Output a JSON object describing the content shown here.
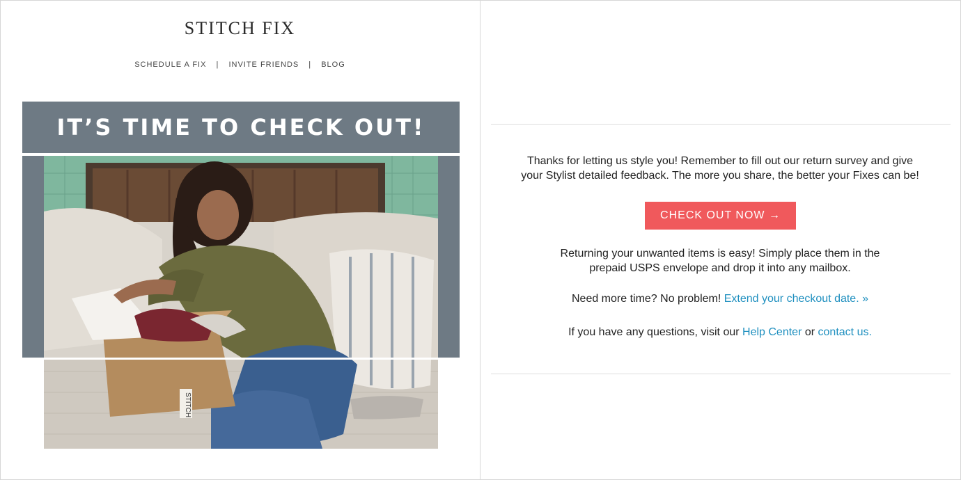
{
  "brand": {
    "logo": "STITCH FIX"
  },
  "nav": {
    "items": [
      "SCHEDULE A FIX",
      "INVITE FRIENDS",
      "BLOG"
    ],
    "separator": "|"
  },
  "banner": {
    "title": "IT’S TIME TO CHECK OUT!",
    "color": "#6e7a84"
  },
  "photo": {
    "box_label": "STITCH"
  },
  "content": {
    "intro_line1": "Thanks for letting us style you! Remember to fill out our return survey and give",
    "intro_line2": "your Stylist detailed feedback. The more you share, the better your Fixes can be!",
    "cta_label": "CHECK OUT NOW →",
    "cta_color": "#f0595c",
    "return_line1": "Returning your unwanted items is easy! Simply place them in the",
    "return_line2": "prepaid USPS envelope and drop it into any mailbox.",
    "more_time_text": "Need more time? No problem!",
    "more_time_link": "Extend your checkout date. »",
    "questions_text": "If you have any questions, visit our",
    "help_center_link": "Help Center",
    "or_text": "or",
    "contact_link": "contact us.",
    "link_color": "#1e8fbf"
  }
}
